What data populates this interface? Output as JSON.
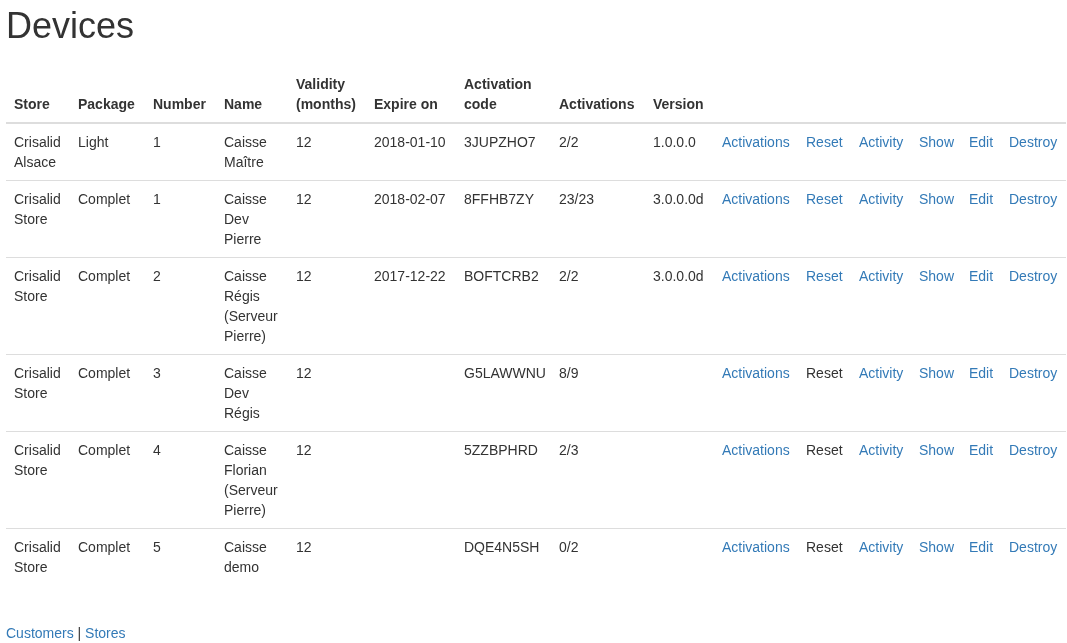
{
  "title": "Devices",
  "table": {
    "columns": [
      "Store",
      "Package",
      "Number",
      "Name",
      "Validity (months)",
      "Expire on",
      "Activation code",
      "Activations",
      "Version"
    ],
    "rows": [
      {
        "cells": [
          "Crisalid Alsace",
          "Light",
          "1",
          "Caisse Maître",
          "12",
          "2018-01-10",
          "3JUPZHO7",
          "2/2",
          "1.0.0.0"
        ],
        "actions": [
          {
            "label": "Activations",
            "disabled": false
          },
          {
            "label": "Reset",
            "disabled": false
          },
          {
            "label": "Activity",
            "disabled": false
          },
          {
            "label": "Show",
            "disabled": false
          },
          {
            "label": "Edit",
            "disabled": false
          },
          {
            "label": "Destroy",
            "disabled": false
          }
        ]
      },
      {
        "cells": [
          "Crisalid Store",
          "Complet",
          "1",
          "Caisse Dev Pierre",
          "12",
          "2018-02-07",
          "8FFHB7ZY",
          "23/23",
          "3.0.0.0d"
        ],
        "actions": [
          {
            "label": "Activations",
            "disabled": false
          },
          {
            "label": "Reset",
            "disabled": false
          },
          {
            "label": "Activity",
            "disabled": false
          },
          {
            "label": "Show",
            "disabled": false
          },
          {
            "label": "Edit",
            "disabled": false
          },
          {
            "label": "Destroy",
            "disabled": false
          }
        ]
      },
      {
        "cells": [
          "Crisalid Store",
          "Complet",
          "2",
          "Caisse Régis (Serveur Pierre)",
          "12",
          "2017-12-22",
          "BOFTCRB2",
          "2/2",
          "3.0.0.0d"
        ],
        "actions": [
          {
            "label": "Activations",
            "disabled": false
          },
          {
            "label": "Reset",
            "disabled": false
          },
          {
            "label": "Activity",
            "disabled": false
          },
          {
            "label": "Show",
            "disabled": false
          },
          {
            "label": "Edit",
            "disabled": false
          },
          {
            "label": "Destroy",
            "disabled": false
          }
        ]
      },
      {
        "cells": [
          "Crisalid Store",
          "Complet",
          "3",
          "Caisse Dev Régis",
          "12",
          "",
          "G5LAWWNU",
          "8/9",
          ""
        ],
        "actions": [
          {
            "label": "Activations",
            "disabled": false
          },
          {
            "label": "Reset",
            "disabled": true
          },
          {
            "label": "Activity",
            "disabled": false
          },
          {
            "label": "Show",
            "disabled": false
          },
          {
            "label": "Edit",
            "disabled": false
          },
          {
            "label": "Destroy",
            "disabled": false
          }
        ]
      },
      {
        "cells": [
          "Crisalid Store",
          "Complet",
          "4",
          "Caisse Florian (Serveur Pierre)",
          "12",
          "",
          "5ZZBPHRD",
          "2/3",
          ""
        ],
        "actions": [
          {
            "label": "Activations",
            "disabled": false
          },
          {
            "label": "Reset",
            "disabled": true
          },
          {
            "label": "Activity",
            "disabled": false
          },
          {
            "label": "Show",
            "disabled": false
          },
          {
            "label": "Edit",
            "disabled": false
          },
          {
            "label": "Destroy",
            "disabled": false
          }
        ]
      },
      {
        "cells": [
          "Crisalid Store",
          "Complet",
          "5",
          "Caisse demo",
          "12",
          "",
          "DQE4N5SH",
          "0/2",
          ""
        ],
        "actions": [
          {
            "label": "Activations",
            "disabled": false
          },
          {
            "label": "Reset",
            "disabled": true
          },
          {
            "label": "Activity",
            "disabled": false
          },
          {
            "label": "Show",
            "disabled": false
          },
          {
            "label": "Edit",
            "disabled": false
          },
          {
            "label": "Destroy",
            "disabled": false
          }
        ]
      }
    ]
  },
  "footer": {
    "links": [
      "Customers",
      "Stores"
    ],
    "separator": "|"
  }
}
